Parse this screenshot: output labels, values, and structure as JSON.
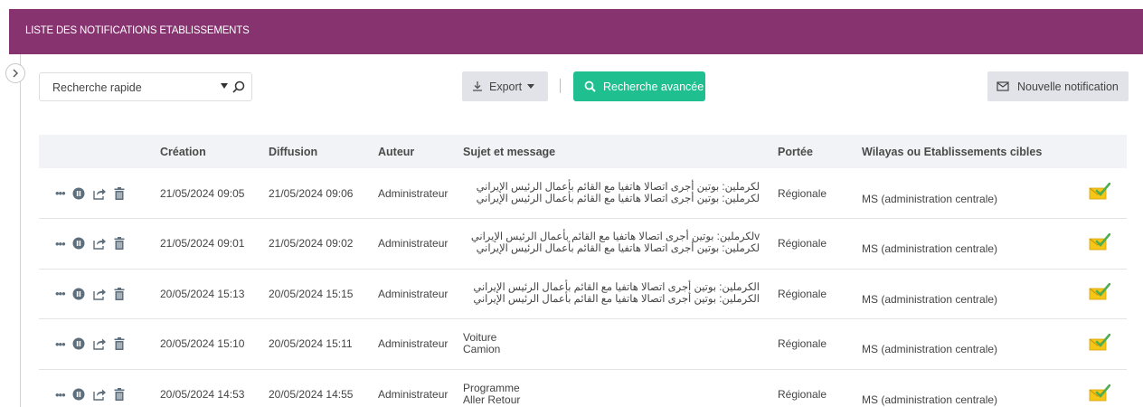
{
  "header": {
    "title": "LISTE DES NOTIFICATIONS ETABLISSEMENTS"
  },
  "toolbar": {
    "search_value": "Recherche rapide",
    "export_label": "Export",
    "advanced_search_label": "Recherche avancée",
    "new_notification_label": "Nouvelle notification"
  },
  "table": {
    "columns": [
      "",
      "Création",
      "Diffusion",
      "Auteur",
      "Sujet et message",
      "Portée",
      "Wilayas ou Etablissements cibles",
      ""
    ],
    "rows": [
      {
        "creation": "21/05/2024 09:05",
        "diffusion": "21/05/2024 09:06",
        "auteur": "Administrateur",
        "sujet": "لكرملين: بوتين أجرى اتصالا هاتفيا مع القائم بأعمال الرئيس الإيراني",
        "message": "لكرملين: بوتين أجرى اتصالا هاتفيا مع القائم بأعمال الرئيس الإيراني",
        "rtl": true,
        "portee": "Régionale",
        "cibles": "MS (administration centrale)"
      },
      {
        "creation": "21/05/2024 09:01",
        "diffusion": "21/05/2024 09:02",
        "auteur": "Administrateur",
        "sujet": "vلكرملين: بوتين أجرى اتصالا هاتفيا مع القائم بأعمال الرئيس الإيراني",
        "message": "لكرملين: بوتين أجرى اتصالا هاتفيا مع القائم بأعمال الرئيس الإيراني",
        "rtl": true,
        "portee": "Régionale",
        "cibles": "MS (administration centrale)"
      },
      {
        "creation": "20/05/2024 15:13",
        "diffusion": "20/05/2024 15:15",
        "auteur": "Administrateur",
        "sujet": "الكرملين: بوتين أجرى اتصالا هاتفيا مع القائم بأعمال الرئيس الإيراني",
        "message": "الكرملين: بوتين أجرى اتصالا هاتفيا مع القائم بأعمال الرئيس الإيراني",
        "rtl": true,
        "portee": "Régionale",
        "cibles": "MS (administration centrale)"
      },
      {
        "creation": "20/05/2024 15:10",
        "diffusion": "20/05/2024 15:11",
        "auteur": "Administrateur",
        "sujet": "Voiture",
        "message": "Camion",
        "rtl": false,
        "portee": "Régionale",
        "cibles": "MS (administration centrale)"
      },
      {
        "creation": "20/05/2024 14:53",
        "diffusion": "20/05/2024 14:55",
        "auteur": "Administrateur",
        "sujet": "Programme",
        "message": "Aller Retour",
        "rtl": false,
        "portee": "Régionale",
        "cibles": "MS (administration centrale)"
      }
    ]
  },
  "colors": {
    "header": "#86336f",
    "accent_green": "#1fbf8f",
    "button_gray": "#e1e3e8",
    "icon_gray": "#5d6e7c",
    "envelope_yellow": "#f5c518",
    "check_green": "#4caf50"
  },
  "icons": {
    "row_actions": [
      "more-icon",
      "pause-icon",
      "share-icon",
      "trash-icon"
    ],
    "status": "envelope-check-icon"
  }
}
